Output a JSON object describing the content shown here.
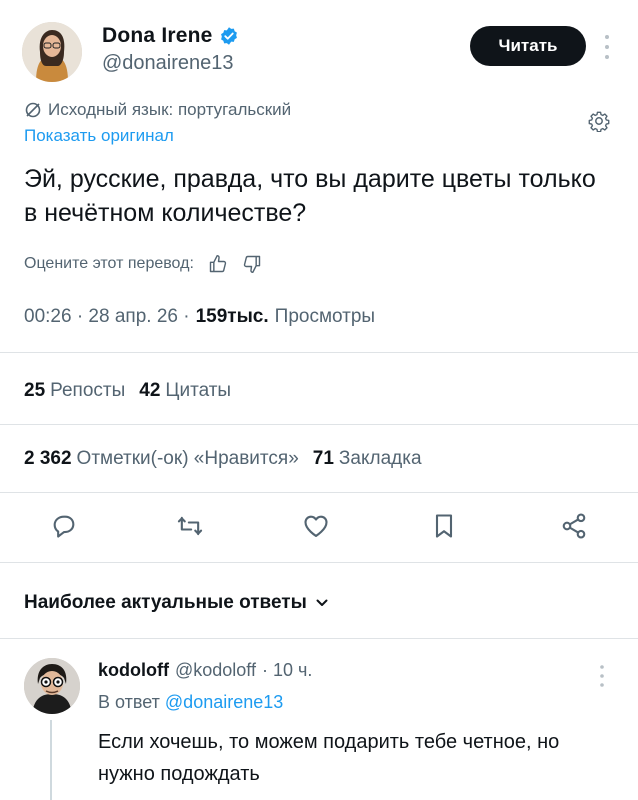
{
  "author": {
    "display_name": "Dona Irene",
    "handle": "@donairene13",
    "follow_label": "Читать"
  },
  "translation": {
    "source_language": "Исходный язык: португальский",
    "show_original": "Показать оригинал",
    "rate_label": "Оцените этот перевод:"
  },
  "tweet": {
    "text": "Эй, русские, правда, что вы дарите цветы только в нечётном количестве?",
    "time": "00:26 · 28 апр. 26 ·",
    "views_count": "159тыс.",
    "views_label": "Просмотры"
  },
  "stats": {
    "reposts_count": "25",
    "reposts_label": "Репосты",
    "quotes_count": "42",
    "quotes_label": "Цитаты",
    "likes_count": "2 362",
    "likes_label": "Отметки(-ок) «Нравится»",
    "bookmarks_count": "71",
    "bookmarks_label": "Закладка"
  },
  "replies_section": {
    "heading": "Наиболее актуальные ответы"
  },
  "reply": {
    "display_name": "kodoloff",
    "handle": "@kodoloff",
    "time": "· 10 ч.",
    "reply_to_prefix": "В ответ",
    "reply_to_handle": "@donairene13",
    "text": "Если хочешь, то можем подарить тебе четное, но нужно подождать"
  },
  "colors": {
    "accent": "#1d9bf0",
    "text_primary": "#0f1419",
    "text_secondary": "#536471",
    "divider": "#dfe3e6"
  },
  "icons": {
    "translate": "translate-off-icon",
    "settings": "gear-icon",
    "thumbs_up": "thumbs-up-icon",
    "thumbs_down": "thumbs-down-icon",
    "reply": "reply-icon",
    "repost": "repost-icon",
    "like": "heart-icon",
    "bookmark": "bookmark-icon",
    "share": "share-icon",
    "more": "more-vertical-icon",
    "verified": "verified-badge-icon"
  }
}
